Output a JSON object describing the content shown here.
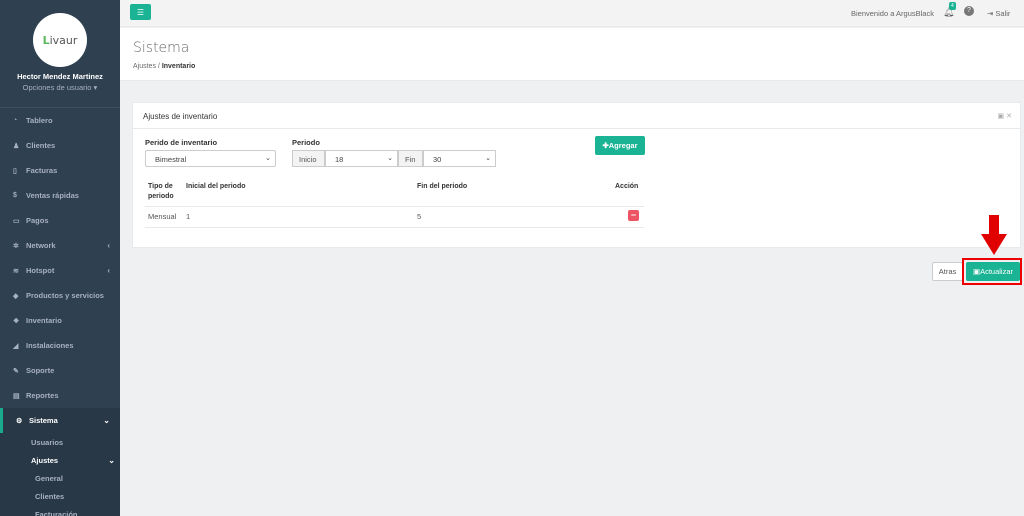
{
  "sidebar": {
    "logo": "Livaur",
    "user_name": "Hector Mendez Martinez",
    "user_options": "Opciones de usuario ▾",
    "items": [
      {
        "label": "Tablero",
        "icon": "dashboard-icon"
      },
      {
        "label": "Clientes",
        "icon": "users-icon"
      },
      {
        "label": "Facturas",
        "icon": "file-icon"
      },
      {
        "label": "Ventas rápidas",
        "icon": "dollar-icon"
      },
      {
        "label": "Pagos",
        "icon": "money-icon"
      },
      {
        "label": "Network",
        "icon": "network-icon"
      },
      {
        "label": "Hotspot",
        "icon": "wifi-icon"
      },
      {
        "label": "Productos y servicios",
        "icon": "tag-icon"
      },
      {
        "label": "Inventario",
        "icon": "cubes-icon"
      },
      {
        "label": "Instalaciones",
        "icon": "tools-icon"
      },
      {
        "label": "Soporte",
        "icon": "wrench-icon"
      },
      {
        "label": "Reportes",
        "icon": "book-icon"
      },
      {
        "label": "Sistema",
        "icon": "gears-icon"
      }
    ],
    "sub_items": [
      "Usuarios",
      "Ajustes"
    ],
    "sub2_items": [
      "General",
      "Clientes",
      "Facturación"
    ]
  },
  "topbar": {
    "welcome": "Bienvenido a ArgusBlack",
    "notif_count": "4",
    "logout": "Salir"
  },
  "heading": {
    "title": "Sistema",
    "crumb_parent": "Ajustes",
    "crumb_current": "Inventario"
  },
  "panel": {
    "title": "Ajustes de inventario",
    "period_label": "Perido de inventario",
    "period_value": "Bimestral",
    "periodo_label": "Periodo",
    "inicio_label": "Inicio",
    "inicio_value": "18",
    "fin_label": "Fin",
    "fin_value": "30",
    "add_button": "Agregar",
    "columns": [
      "Tipo de periodo",
      "Inicial del periodo",
      "Fin del periodo",
      "Acción"
    ],
    "rows": [
      {
        "tipo": "Mensual",
        "inicial": "1",
        "fin": "5"
      }
    ]
  },
  "footer": {
    "back": "Atras",
    "update": "Actualizar"
  },
  "colors": {
    "sidebar": "#2f4050",
    "accent": "#1ab394",
    "danger": "#ed5565",
    "highlight": "#e00000"
  }
}
